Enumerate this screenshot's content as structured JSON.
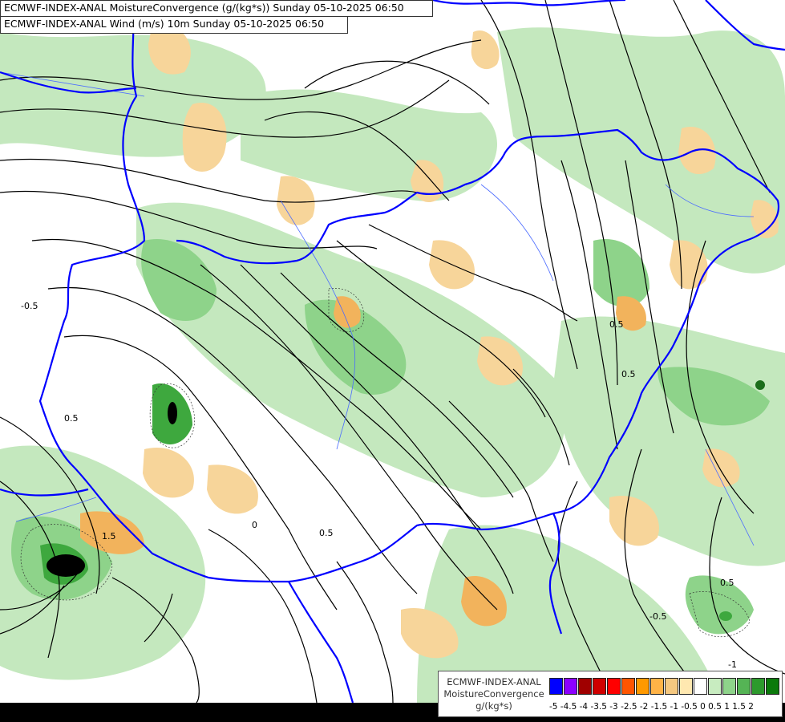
{
  "titles": {
    "line1": "ECMWF-INDEX-ANAL MoistureConvergence (g/(kg*s)) Sunday 05-10-2025 06:50",
    "line2": "ECMWF-INDEX-ANAL Wind (m/s) 10m Sunday 05-10-2025 06:50"
  },
  "contour_labels": [
    "0",
    "0.5",
    "-0.5",
    "1.5",
    "-1",
    "0.5",
    "0.5",
    "-0.5",
    "0.5",
    "0.5"
  ],
  "legend": {
    "source": "ECMWF-INDEX-ANAL",
    "param": "MoistureConvergence",
    "unit": "g/(kg*s)",
    "tick_text": "-5 -4.5 -4 -3.5 -3 -2.5 -2 -1.5 -1 -0.5  0  0.5  1  1.5  2",
    "colors": [
      "#0000ff",
      "#8c00ff",
      "#a00000",
      "#d00000",
      "#ff0000",
      "#ff5500",
      "#ff9900",
      "#ffb347",
      "#f5c880",
      "#ffe8b0",
      "#ffffff",
      "#c8ecc0",
      "#8ed38a",
      "#55b455",
      "#2d9a2d",
      "#0b7a0b"
    ]
  },
  "palette": {
    "green_light": "#c4e8be",
    "green_mid": "#8ed38a",
    "green_dark": "#3ea83e",
    "orange_light": "#f7d59a",
    "orange_mid": "#f2b35c",
    "border_blue": "#0000ff",
    "river_blue": "#4b6bff"
  }
}
